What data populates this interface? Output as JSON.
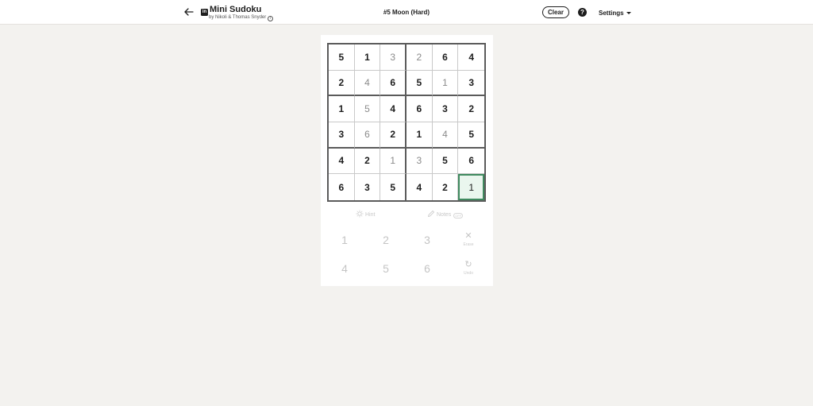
{
  "header": {
    "app_title": "Mini Sudoku",
    "byline": "by Nikoli & Thomas Snyder",
    "logo_text": "in",
    "puzzle_name": "#5 Moon (Hard)",
    "clear_label": "Clear",
    "help_symbol": "?",
    "settings_label": "Settings"
  },
  "board": {
    "rows": [
      [
        {
          "v": "5",
          "t": "given"
        },
        {
          "v": "1",
          "t": "given"
        },
        {
          "v": "3",
          "t": "user"
        },
        {
          "v": "2",
          "t": "user"
        },
        {
          "v": "6",
          "t": "given"
        },
        {
          "v": "4",
          "t": "given"
        }
      ],
      [
        {
          "v": "2",
          "t": "given"
        },
        {
          "v": "4",
          "t": "user"
        },
        {
          "v": "6",
          "t": "given"
        },
        {
          "v": "5",
          "t": "given"
        },
        {
          "v": "1",
          "t": "user"
        },
        {
          "v": "3",
          "t": "given"
        }
      ],
      [
        {
          "v": "1",
          "t": "given"
        },
        {
          "v": "5",
          "t": "user"
        },
        {
          "v": "4",
          "t": "given"
        },
        {
          "v": "6",
          "t": "given"
        },
        {
          "v": "3",
          "t": "given"
        },
        {
          "v": "2",
          "t": "given"
        }
      ],
      [
        {
          "v": "3",
          "t": "given"
        },
        {
          "v": "6",
          "t": "user"
        },
        {
          "v": "2",
          "t": "given"
        },
        {
          "v": "1",
          "t": "given"
        },
        {
          "v": "4",
          "t": "user"
        },
        {
          "v": "5",
          "t": "given"
        }
      ],
      [
        {
          "v": "4",
          "t": "given"
        },
        {
          "v": "2",
          "t": "given"
        },
        {
          "v": "1",
          "t": "user"
        },
        {
          "v": "3",
          "t": "user"
        },
        {
          "v": "5",
          "t": "given"
        },
        {
          "v": "6",
          "t": "given"
        }
      ],
      [
        {
          "v": "6",
          "t": "given"
        },
        {
          "v": "3",
          "t": "given"
        },
        {
          "v": "5",
          "t": "given"
        },
        {
          "v": "4",
          "t": "given"
        },
        {
          "v": "2",
          "t": "given"
        },
        {
          "v": "1",
          "t": "selected"
        }
      ]
    ],
    "accent_color": "#3f8a5f"
  },
  "tools": {
    "hint_label": "Hint",
    "notes_label": "Notes",
    "notes_toggle_text": "OFF"
  },
  "keypad": {
    "row1": [
      "1",
      "2",
      "3"
    ],
    "row2": [
      "4",
      "5",
      "6"
    ],
    "erase_label": "Erase",
    "undo_label": "Undo"
  }
}
